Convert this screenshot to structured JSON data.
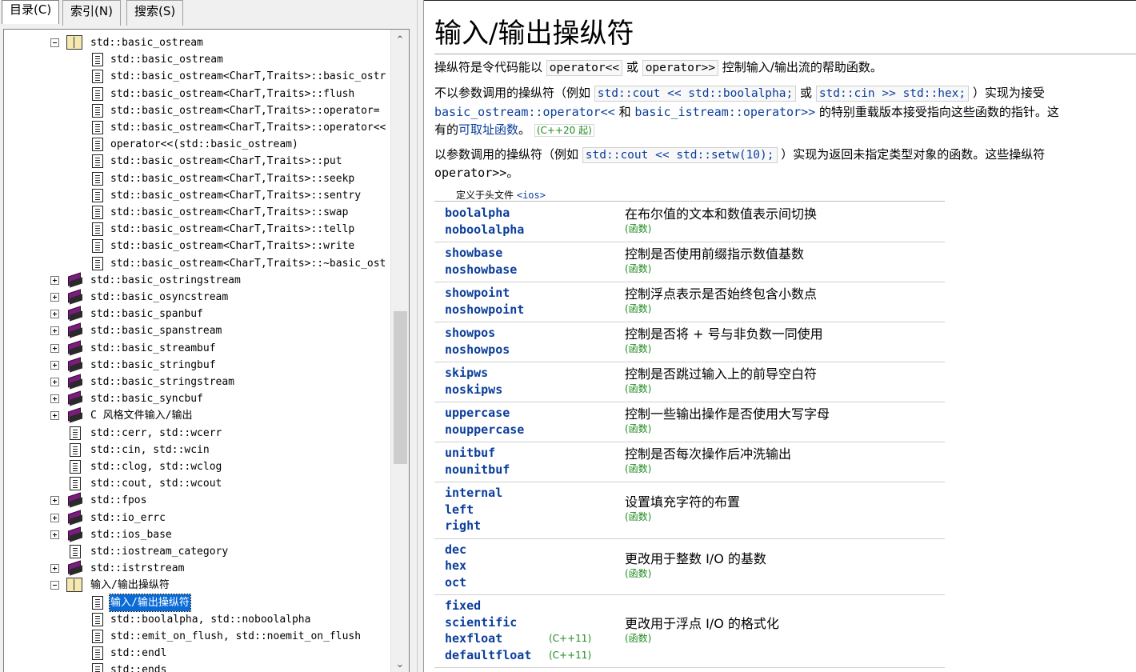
{
  "tabs": [
    {
      "label": "目录(C)",
      "active": true
    },
    {
      "label": "索引(N)",
      "active": false
    },
    {
      "label": "搜索(S)",
      "active": false
    }
  ],
  "tree": [
    {
      "label": "std::basic_ostream",
      "level": 2,
      "icon": "open-book-icon",
      "expander": "minus"
    },
    {
      "label": "std::basic_ostream",
      "level": 3,
      "icon": "page-icon"
    },
    {
      "label": "std::basic_ostream<CharT,Traits>::basic_ostr",
      "level": 3,
      "icon": "page-icon"
    },
    {
      "label": "std::basic_ostream<CharT,Traits>::flush",
      "level": 3,
      "icon": "page-icon"
    },
    {
      "label": "std::basic_ostream<CharT,Traits>::operator=",
      "level": 3,
      "icon": "page-icon"
    },
    {
      "label": "std::basic_ostream<CharT,Traits>::operator<<",
      "level": 3,
      "icon": "page-icon"
    },
    {
      "label": "operator<<(std::basic_ostream)",
      "level": 3,
      "icon": "page-icon"
    },
    {
      "label": "std::basic_ostream<CharT,Traits>::put",
      "level": 3,
      "icon": "page-icon"
    },
    {
      "label": "std::basic_ostream<CharT,Traits>::seekp",
      "level": 3,
      "icon": "page-icon"
    },
    {
      "label": "std::basic_ostream<CharT,Traits>::sentry",
      "level": 3,
      "icon": "page-icon"
    },
    {
      "label": "std::basic_ostream<CharT,Traits>::swap",
      "level": 3,
      "icon": "page-icon"
    },
    {
      "label": "std::basic_ostream<CharT,Traits>::tellp",
      "level": 3,
      "icon": "page-icon"
    },
    {
      "label": "std::basic_ostream<CharT,Traits>::write",
      "level": 3,
      "icon": "page-icon"
    },
    {
      "label": "std::basic_ostream<CharT,Traits>::~basic_ost",
      "level": 3,
      "icon": "page-icon"
    },
    {
      "label": "std::basic_ostringstream",
      "level": 2,
      "icon": "book-icon",
      "expander": "plus"
    },
    {
      "label": "std::basic_osyncstream",
      "level": 2,
      "icon": "book-icon",
      "expander": "plus"
    },
    {
      "label": "std::basic_spanbuf",
      "level": 2,
      "icon": "book-icon",
      "expander": "plus"
    },
    {
      "label": "std::basic_spanstream",
      "level": 2,
      "icon": "book-icon",
      "expander": "plus"
    },
    {
      "label": "std::basic_streambuf",
      "level": 2,
      "icon": "book-icon",
      "expander": "plus"
    },
    {
      "label": "std::basic_stringbuf",
      "level": 2,
      "icon": "book-icon",
      "expander": "plus"
    },
    {
      "label": "std::basic_stringstream",
      "level": 2,
      "icon": "book-icon",
      "expander": "plus"
    },
    {
      "label": "std::basic_syncbuf",
      "level": 2,
      "icon": "book-icon",
      "expander": "plus"
    },
    {
      "label": "C 风格文件输入/输出",
      "level": 2,
      "icon": "book-icon",
      "expander": "plus"
    },
    {
      "label": "std::cerr, std::wcerr",
      "level": 2,
      "icon": "page-icon"
    },
    {
      "label": "std::cin, std::wcin",
      "level": 2,
      "icon": "page-icon"
    },
    {
      "label": "std::clog, std::wclog",
      "level": 2,
      "icon": "page-icon"
    },
    {
      "label": "std::cout, std::wcout",
      "level": 2,
      "icon": "page-icon"
    },
    {
      "label": "std::fpos",
      "level": 2,
      "icon": "book-icon",
      "expander": "plus"
    },
    {
      "label": "std::io_errc",
      "level": 2,
      "icon": "book-icon",
      "expander": "plus"
    },
    {
      "label": "std::ios_base",
      "level": 2,
      "icon": "book-icon",
      "expander": "plus"
    },
    {
      "label": "std::iostream_category",
      "level": 2,
      "icon": "page-icon"
    },
    {
      "label": "std::istrstream",
      "level": 2,
      "icon": "book-icon",
      "expander": "plus"
    },
    {
      "label": "输入/输出操纵符",
      "level": 2,
      "icon": "open-book-icon",
      "expander": "minus"
    },
    {
      "label": "输入/输出操纵符",
      "level": 3,
      "icon": "page-icon",
      "selected": true
    },
    {
      "label": "std::boolalpha, std::noboolalpha",
      "level": 3,
      "icon": "page-icon"
    },
    {
      "label": "std::emit_on_flush, std::noemit_on_flush",
      "level": 3,
      "icon": "page-icon"
    },
    {
      "label": "std::endl",
      "level": 3,
      "icon": "page-icon"
    },
    {
      "label": "std::ends",
      "level": 3,
      "icon": "page-icon"
    }
  ],
  "article": {
    "title": "输入/输出操纵符",
    "intro": {
      "t1": "操纵符是令代码能以",
      "c1": "operator<<",
      "t2": "或",
      "c2": "operator>>",
      "t3": "控制输入/输出流的帮助函数。"
    },
    "p2": {
      "t1": "不以参数调用的操纵符（例如",
      "c1": "std::cout << std::boolalpha;",
      "t2": "或",
      "c2": "std::cin >> std::hex;",
      "t3": "）实现为接受",
      "l1": "basic_ostream::operator<<",
      "t4": "和",
      "l2": "basic_istream::operator>>",
      "t5": "的特别重载版本接受指向这些函数的指针。这",
      "t6": "有的",
      "l3": "可取址函数",
      "t7": "。",
      "since": "(C++20 起)"
    },
    "p3": {
      "t1": "以参数调用的操纵符（例如",
      "c1": "std::cout << std::setw(10);",
      "t2": "）实现为返回未指定类型对象的函数。这些操纵符",
      "t3": "operator>>",
      "t4": "。"
    },
    "defined_in": {
      "label": "定义于头文件",
      "header": "<ios>"
    },
    "manipulators": [
      {
        "names": [
          "boolalpha",
          "noboolalpha"
        ],
        "versions": [
          "",
          ""
        ],
        "desc": "在布尔值的文本和数值表示间切换",
        "kind": "(函数)"
      },
      {
        "names": [
          "showbase",
          "noshowbase"
        ],
        "versions": [
          "",
          ""
        ],
        "desc": "控制是否使用前缀指示数值基数",
        "kind": "(函数)"
      },
      {
        "names": [
          "showpoint",
          "noshowpoint"
        ],
        "versions": [
          "",
          ""
        ],
        "desc": "控制浮点表示是否始终包含小数点",
        "kind": "(函数)"
      },
      {
        "names": [
          "showpos",
          "noshowpos"
        ],
        "versions": [
          "",
          ""
        ],
        "desc": "控制是否将 + 号与非负数一同使用",
        "kind": "(函数)"
      },
      {
        "names": [
          "skipws",
          "noskipws"
        ],
        "versions": [
          "",
          ""
        ],
        "desc": "控制是否跳过输入上的前导空白符",
        "kind": "(函数)"
      },
      {
        "names": [
          "uppercase",
          "nouppercase"
        ],
        "versions": [
          "",
          ""
        ],
        "desc": "控制一些输出操作是否使用大写字母",
        "kind": "(函数)"
      },
      {
        "names": [
          "unitbuf",
          "nounitbuf"
        ],
        "versions": [
          "",
          ""
        ],
        "desc": "控制是否每次操作后冲洗输出",
        "kind": "(函数)"
      },
      {
        "names": [
          "internal",
          "left",
          "right"
        ],
        "versions": [
          "",
          "",
          ""
        ],
        "desc": "设置填充字符的布置",
        "kind": "(函数)"
      },
      {
        "names": [
          "dec",
          "hex",
          "oct"
        ],
        "versions": [
          "",
          "",
          ""
        ],
        "desc": "更改用于整数 I/O 的基数",
        "kind": "(函数)"
      },
      {
        "names": [
          "fixed",
          "scientific",
          "hexfloat",
          "defaultfloat"
        ],
        "versions": [
          "",
          "",
          "(C++11)",
          "(C++11)"
        ],
        "desc": "更改用于浮点 I/O 的格式化",
        "kind": "(函数)"
      }
    ]
  },
  "colors": {
    "link": "#0b3e9b",
    "version": "#228b22",
    "selection": "#0a6bd6"
  }
}
